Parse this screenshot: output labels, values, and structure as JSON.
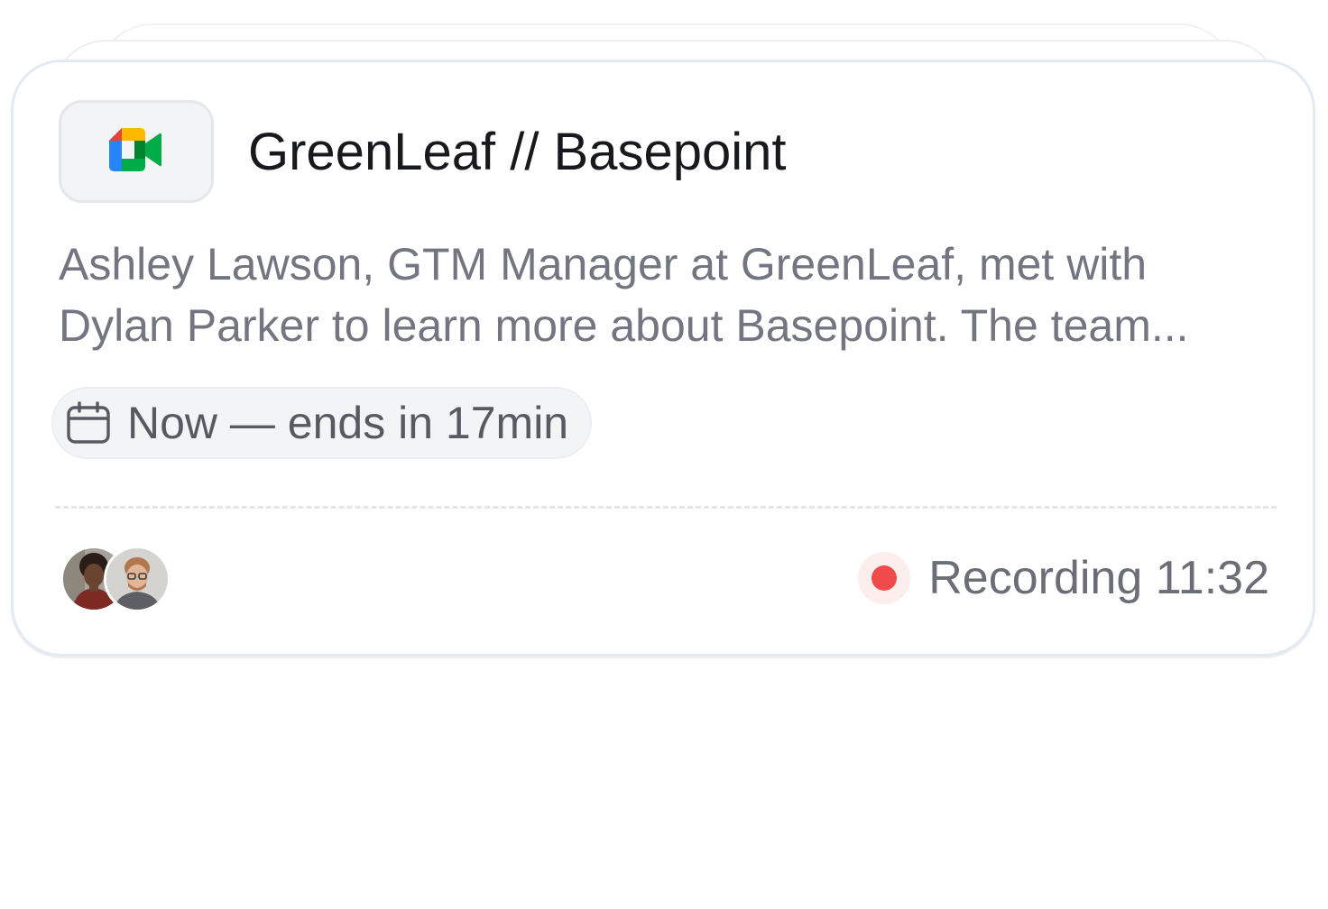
{
  "meeting": {
    "app_icon": "google-meet-icon",
    "title": "GreenLeaf // Basepoint",
    "description_line1": "Ashley Lawson, GTM Manager at GreenLeaf, met with",
    "description_line2": "Dylan Parker to learn more about Basepoint. The team...",
    "time_icon": "calendar-icon",
    "time_status": "Now — ends in 17min",
    "participants": [
      {
        "avatar": "participant-avatar-1"
      },
      {
        "avatar": "participant-avatar-2"
      }
    ],
    "recording_label": "Recording 11:32"
  },
  "colors": {
    "recording_dot": "#ef4b4b",
    "title_text": "#18191c",
    "muted_text": "#737680",
    "card_border": "#e2ebf3"
  }
}
